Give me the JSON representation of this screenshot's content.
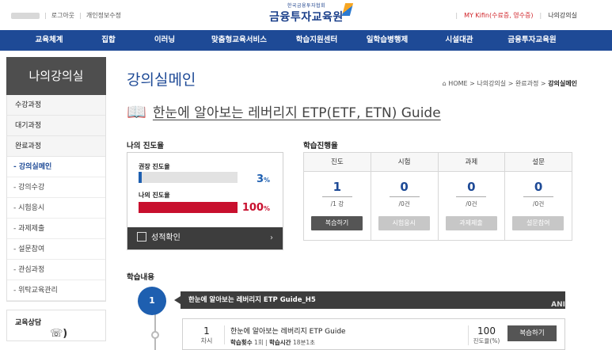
{
  "top": {
    "logout": "로그아웃",
    "privacy": "개인정보수정",
    "logo_small": "한국금융투자협회",
    "logo_big": "금융투자교육원",
    "mykifin": "MY Kifin(수료증, 영수증)",
    "my_lecture": "나의강의실"
  },
  "nav": [
    "교육체계",
    "집합",
    "이러닝",
    "맞춤형교육서비스",
    "학습지원센터",
    "일학습병행제",
    "시설대관",
    "금융투자교육원"
  ],
  "sidebar": {
    "title": "나의강의실",
    "groups": [
      "수강과정",
      "대기과정",
      "완료과정"
    ],
    "subs": [
      "- 강의실메인",
      "- 강의수강",
      "- 시험응시",
      "- 과제제출",
      "- 설문참여",
      "- 관심과정",
      "- 위탁교육관리"
    ],
    "consult": "교육상담"
  },
  "page": {
    "title": "강의실메인",
    "breadcrumb_prefix": "HOME > 나의강의실 > 완료과정 > ",
    "breadcrumb_current": "강의실메인",
    "course_title": "한눈에 알아보는 레버리지 ETP(ETF, ETN) Guide"
  },
  "progress": {
    "label": "나의 진도율",
    "recommended_label": "권장 진도율",
    "recommended_value": "3",
    "my_label": "나의 진도율",
    "my_value": "100",
    "pct_unit": "%",
    "recommended_fraction": 0.03,
    "my_fraction": 1.0,
    "grade_button": "성적확인",
    "colors": {
      "recommended": "#1e5fb0",
      "mine": "#c8102e"
    }
  },
  "status": {
    "label": "학습진행율",
    "columns": [
      {
        "header": "진도",
        "value": "1",
        "denominator": "/1 강",
        "button": "복습하기",
        "active": true
      },
      {
        "header": "시험",
        "value": "0",
        "denominator": "/0건",
        "button": "시험응시",
        "active": false
      },
      {
        "header": "과제",
        "value": "0",
        "denominator": "/0건",
        "button": "과제제출",
        "active": false
      },
      {
        "header": "설문",
        "value": "0",
        "denominator": "/0건",
        "button": "설문참여",
        "active": false
      }
    ]
  },
  "learning": {
    "label": "학습내용",
    "chapter_no": "1",
    "chapter_title": "한눈에 알아보는 레버리지 ETP Guide_H5",
    "ani": "ANI",
    "lesson": {
      "no": "1",
      "no_unit": "차시",
      "name": "한눈에 알아보는 레버리지 ETP Guide",
      "count_label": "학습횟수",
      "count_value": "1회",
      "time_label": "학습시간",
      "time_value": "18분1초",
      "progress_value": "100",
      "progress_unit": "진도율(%)",
      "review_button": "복습하기"
    }
  }
}
